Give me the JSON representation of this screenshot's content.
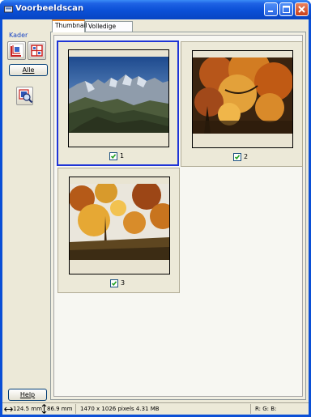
{
  "window": {
    "title": "Voorbeeldscan"
  },
  "left_panel": {
    "kader_label": "Kader",
    "alle_label": "Alle",
    "help_label": "Help",
    "tools": [
      "crop-auto-icon",
      "crop-layout-icon",
      "zoom-preview-icon"
    ]
  },
  "tabs": [
    {
      "label": "Thumbnail",
      "active": true
    },
    {
      "label": "Volledige grootte",
      "active": false
    }
  ],
  "thumbnails": [
    {
      "index": "1",
      "checked": true,
      "selected": true,
      "subject": "mountain-landscape"
    },
    {
      "index": "2",
      "checked": true,
      "selected": false,
      "subject": "autumn-tree-orange"
    },
    {
      "index": "3",
      "checked": true,
      "selected": false,
      "subject": "autumn-forest-sky"
    }
  ],
  "status": {
    "width": "124.5 mm",
    "height": "86.9 mm",
    "pixels": "1470 x 1026 pixels 4.31 MB",
    "rgb": "R:  G:  B:"
  },
  "colors": {
    "title_bar": "#0a4fd6",
    "selection_border": "#1f35d6",
    "active_tab_accent": "#e68b2c"
  }
}
